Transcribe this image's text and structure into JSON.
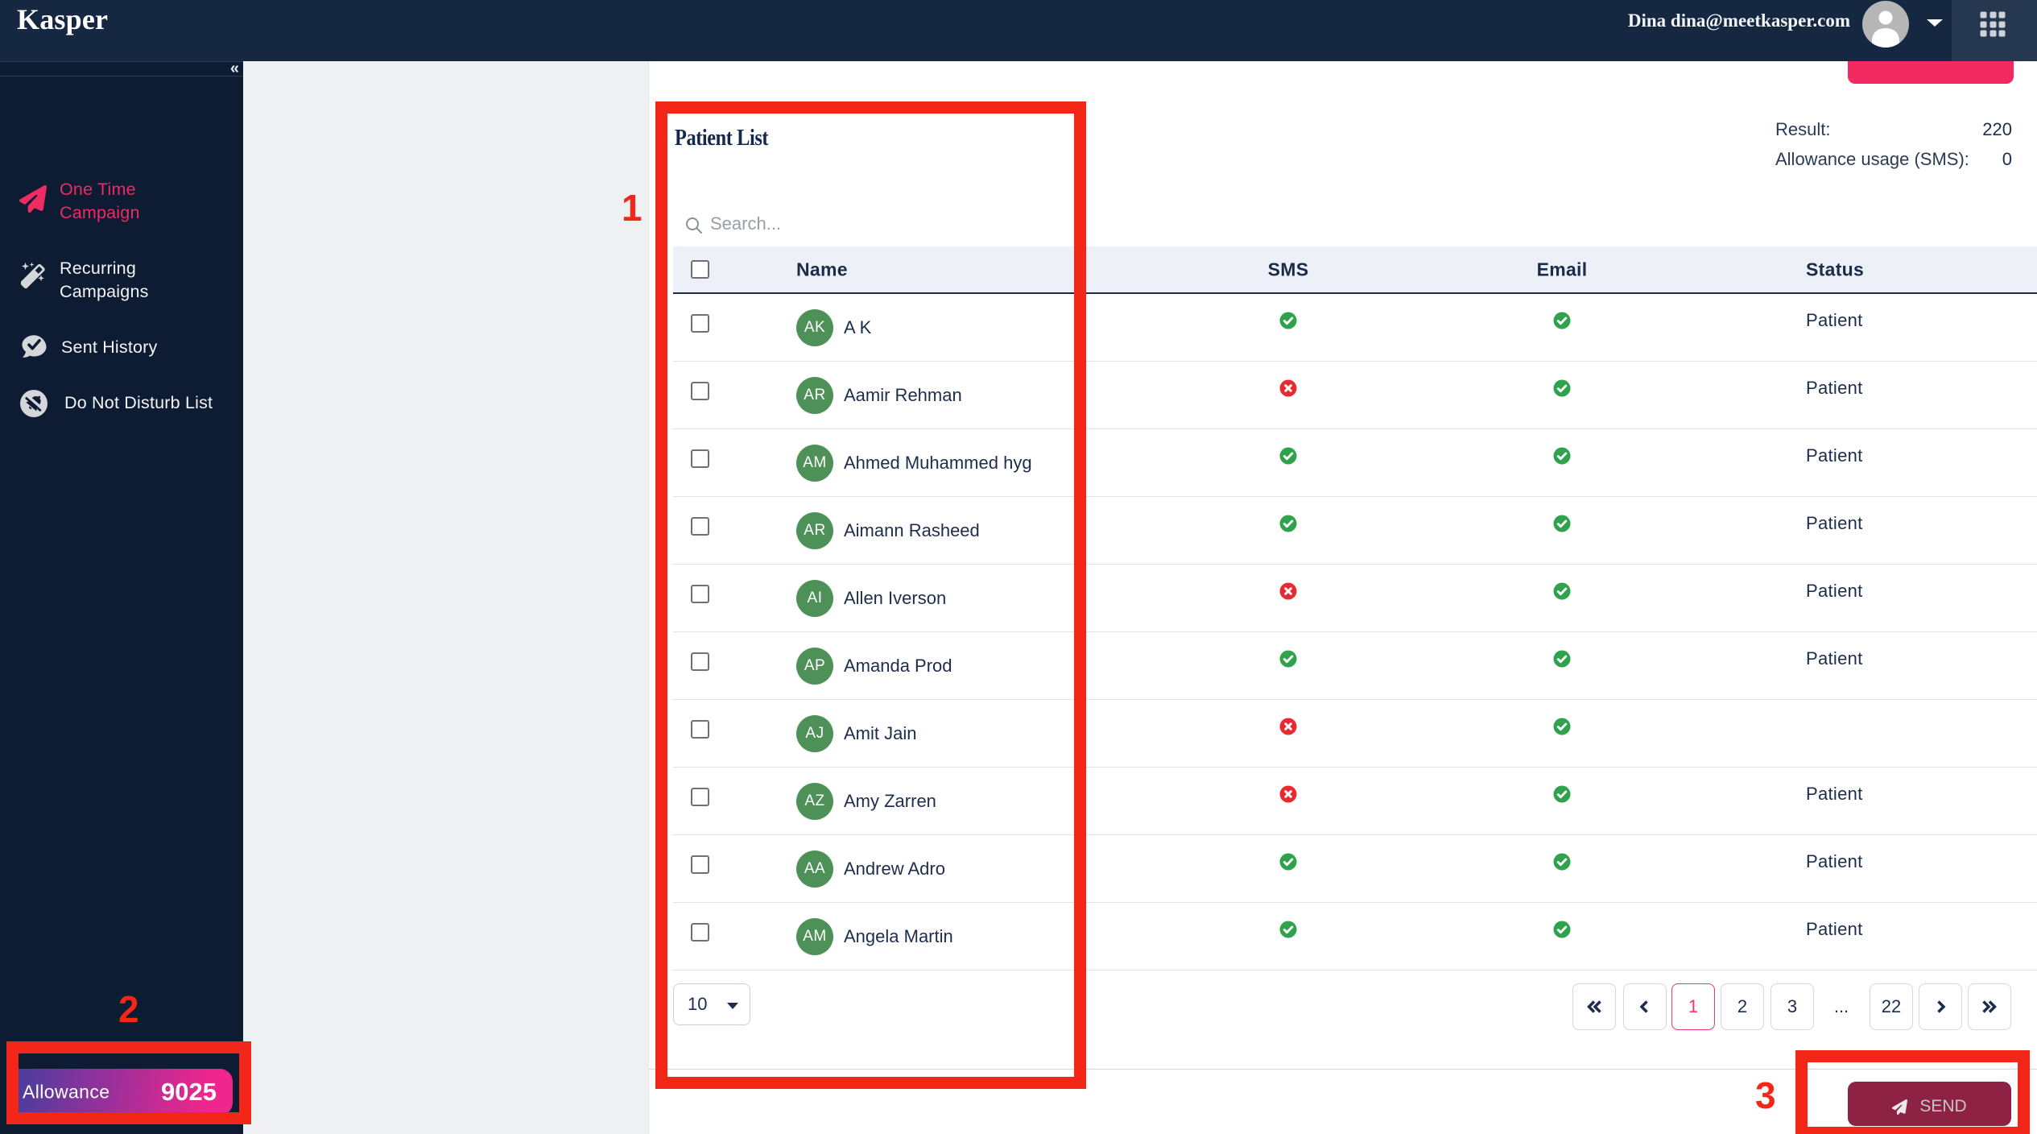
{
  "brand": {
    "logo": "Kasper"
  },
  "header": {
    "user": "Dina dina@meetkasper.com",
    "icons": {
      "avatar": "person-icon",
      "caret": "chevron-down-icon",
      "apps": "apps-grid-icon"
    }
  },
  "sidebar": {
    "collapse_icon": "«",
    "items": [
      {
        "label_line1": "One Time",
        "label_line2": "Campaign",
        "icon": "paper-plane-icon",
        "active": true
      },
      {
        "label_line1": "Recurring",
        "label_line2": "Campaigns",
        "icon": "magic-wand-icon",
        "active": false
      },
      {
        "label_line1": "Sent History",
        "label_line2": "",
        "icon": "chat-check-icon",
        "active": false
      },
      {
        "label_line1": "Do Not Disturb List",
        "label_line2": "",
        "icon": "bell-off-icon",
        "active": false
      }
    ],
    "allowance": {
      "label": "Allowance",
      "value": "9025"
    }
  },
  "summary": {
    "result_label": "Result:",
    "result_value": "220",
    "allowance_label": "Allowance usage (SMS):",
    "allowance_value": "0"
  },
  "patient_list": {
    "title": "Patient List",
    "search_placeholder": "Search...",
    "columns": {
      "name": "Name",
      "sms": "SMS",
      "email": "Email",
      "status": "Status"
    },
    "rows": [
      {
        "initials": "AK",
        "name": "A K",
        "sms": true,
        "email": true,
        "status": "Patient"
      },
      {
        "initials": "AR",
        "name": "Aamir Rehman",
        "sms": false,
        "email": true,
        "status": "Patient"
      },
      {
        "initials": "AM",
        "name": "Ahmed Muhammed hyg",
        "sms": true,
        "email": true,
        "status": "Patient"
      },
      {
        "initials": "AR",
        "name": "Aimann Rasheed",
        "sms": true,
        "email": true,
        "status": "Patient"
      },
      {
        "initials": "AI",
        "name": "Allen Iverson",
        "sms": false,
        "email": true,
        "status": "Patient"
      },
      {
        "initials": "AP",
        "name": "Amanda Prod",
        "sms": true,
        "email": true,
        "status": "Patient"
      },
      {
        "initials": "AJ",
        "name": "Amit Jain",
        "sms": false,
        "email": true,
        "status": ""
      },
      {
        "initials": "AZ",
        "name": "Amy Zarren",
        "sms": false,
        "email": true,
        "status": "Patient"
      },
      {
        "initials": "AA",
        "name": "Andrew Adro",
        "sms": true,
        "email": true,
        "status": "Patient"
      },
      {
        "initials": "AM",
        "name": "Angela Martin",
        "sms": true,
        "email": true,
        "status": "Patient"
      }
    ]
  },
  "pagination": {
    "page_size": "10",
    "pages": [
      "1",
      "2",
      "3",
      "...",
      "22"
    ],
    "current_page": "1"
  },
  "send": {
    "label": "SEND"
  },
  "annotations": {
    "labels": [
      "1",
      "2",
      "3"
    ]
  },
  "colors": {
    "header_navy": "#152741",
    "sidebar_navy": "#0d1b33",
    "accent_pink": "#ee2b63",
    "annotation_red": "#f22718",
    "avatar_green": "#4e9158",
    "check_green": "#31a24c",
    "cross_red": "#ea2830",
    "send_maroon": "#8e2245"
  }
}
